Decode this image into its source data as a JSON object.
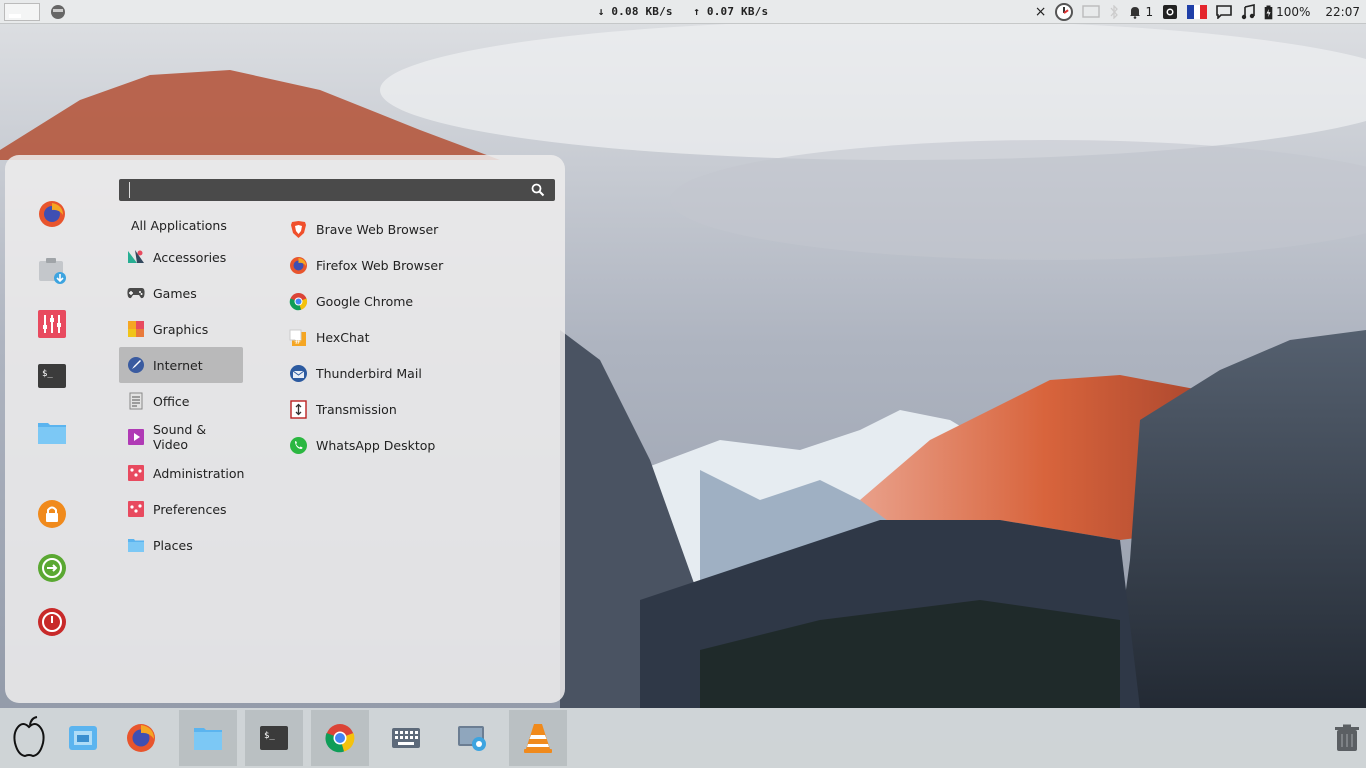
{
  "top_panel": {
    "net_down": "↓ 0.08 KB/s",
    "net_up": "↑ 0.07 KB/s",
    "notification_count": "1",
    "battery_percent": "100%",
    "clock": "22:07"
  },
  "menu": {
    "search": {
      "value": "",
      "placeholder": ""
    },
    "favorites": [
      "firefox-icon",
      "software-install-icon",
      "settings-mixer-icon",
      "terminal-icon",
      "folder-icon",
      "lock-icon",
      "logout-icon",
      "power-icon"
    ],
    "categories": [
      {
        "label": "All Applications",
        "icon": ""
      },
      {
        "label": "Accessories",
        "icon": "accessories-icon"
      },
      {
        "label": "Games",
        "icon": "gamepad-icon"
      },
      {
        "label": "Graphics",
        "icon": "graphics-icon"
      },
      {
        "label": "Internet",
        "icon": "internet-icon",
        "selected": true
      },
      {
        "label": "Office",
        "icon": "office-icon"
      },
      {
        "label": "Sound & Video",
        "icon": "media-icon"
      },
      {
        "label": "Administration",
        "icon": "admin-icon"
      },
      {
        "label": "Preferences",
        "icon": "preferences-icon"
      },
      {
        "label": "Places",
        "icon": "folder-icon"
      }
    ],
    "apps": [
      {
        "label": "Brave Web Browser",
        "icon": "brave-icon"
      },
      {
        "label": "Firefox Web Browser",
        "icon": "firefox-icon"
      },
      {
        "label": "Google Chrome",
        "icon": "chrome-icon"
      },
      {
        "label": "HexChat",
        "icon": "hexchat-icon"
      },
      {
        "label": "Thunderbird Mail",
        "icon": "thunderbird-icon"
      },
      {
        "label": "Transmission",
        "icon": "transmission-icon"
      },
      {
        "label": "WhatsApp Desktop",
        "icon": "whatsapp-icon"
      }
    ]
  },
  "dock": {
    "items": [
      "apple-menu-icon",
      "file-manager-icon",
      "firefox-icon",
      "folder-icon",
      "terminal-icon",
      "chrome-icon",
      "keyboard-icon",
      "screenshot-icon",
      "vlc-icon",
      "trash-icon"
    ]
  },
  "colors": {
    "accent_red": "#e84a5f",
    "folder_blue": "#5bb4ef",
    "firefox_orange": "#e8552d"
  }
}
